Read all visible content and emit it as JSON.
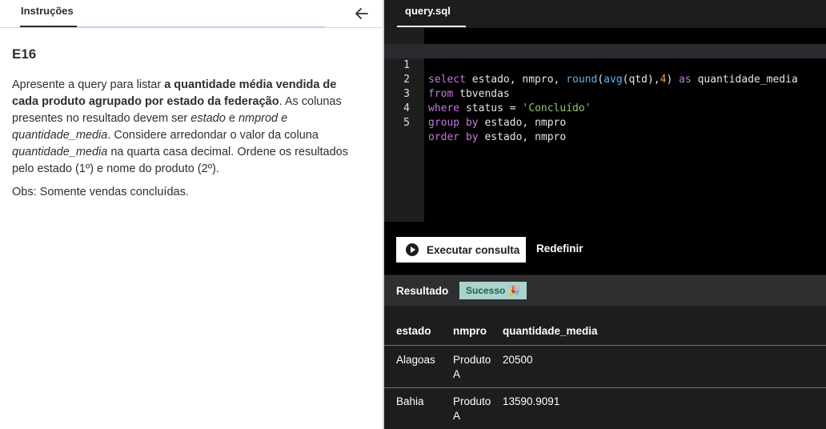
{
  "instructions_panel": {
    "tab_label": "Instruções",
    "exercise_title": "E16",
    "p1": "Apresente a query para listar ",
    "p1_bold": "a quantidade média vendida de cada produto agrupado por estado da federação",
    "p1_b": ". As colunas presentes no resultado devem ser ",
    "p1_i1": "estado",
    "p1_c": " e ",
    "p1_i2": "nmprod e quantidade_media",
    "p1_d": ". Considere arredondar o valor da coluna ",
    "p1_i3": "quantidade_media",
    "p1_e": " na quarta casa decimal. Ordene os resultados pelo estado (1º) e nome do produto (2º).",
    "obs": "Obs: Somente vendas concluídas."
  },
  "editor": {
    "file_tab": "query.sql",
    "line_numbers": [
      "1",
      "2",
      "3",
      "4",
      "5"
    ],
    "lines": [
      "select estado, nmpro, round(avg(qtd),4) as quantidade_media",
      "from tbvendas",
      "where status = 'Concluído'",
      "group by estado, nmpro",
      "order by estado, nmpro"
    ]
  },
  "actions": {
    "run_label": "Executar consulta",
    "reset_label": "Redefinir"
  },
  "result": {
    "title": "Resultado",
    "badge": "Sucesso",
    "badge_icon": "party-popper-icon",
    "columns": [
      "estado",
      "nmpro",
      "quantidade_media"
    ],
    "rows": [
      {
        "estado": "Alagoas",
        "nmpro_1": "Produto",
        "nmpro_2": "A",
        "quantidade_media": "20500"
      },
      {
        "estado": "Bahia",
        "nmpro_1": "Produto",
        "nmpro_2": "A",
        "quantidade_media": "13590.9091"
      }
    ]
  },
  "colors": {
    "editor_bg": "#000000",
    "panel_dark": "#1c1d1f",
    "success_badge_bg": "#acd2cc",
    "keyword": "#c678dd",
    "function": "#61afef",
    "number": "#e5a04a",
    "string": "#98c379"
  }
}
